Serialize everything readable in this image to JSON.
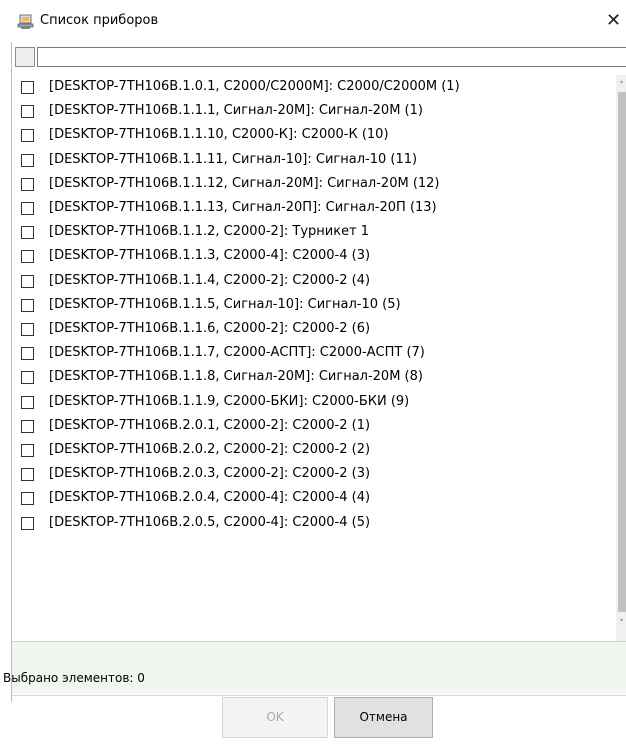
{
  "window": {
    "title": "Список приборов",
    "close_glyph": "✕",
    "app_icon": "device-list-icon",
    "close_icon": "close-icon"
  },
  "filter": {
    "value": "",
    "placeholder": ""
  },
  "items": [
    "[DESKTOP-7TH106B.1.0.1, С2000/С2000М]: С2000/С2000М (1)",
    "[DESKTOP-7TH106B.1.1.1, Сигнал-20М]: Сигнал-20М (1)",
    "[DESKTOP-7TH106B.1.1.10, С2000-К]: С2000-К (10)",
    "[DESKTOP-7TH106B.1.1.11, Сигнал-10]: Сигнал-10 (11)",
    "[DESKTOP-7TH106B.1.1.12, Сигнал-20М]: Сигнал-20М (12)",
    "[DESKTOP-7TH106B.1.1.13, Сигнал-20П]: Сигнал-20П (13)",
    "[DESKTOP-7TH106B.1.1.2, С2000-2]: Турникет 1",
    "[DESKTOP-7TH106B.1.1.3, С2000-4]: С2000-4 (3)",
    "[DESKTOP-7TH106B.1.1.4, С2000-2]: С2000-2 (4)",
    "[DESKTOP-7TH106B.1.1.5, Сигнал-10]: Сигнал-10 (5)",
    "[DESKTOP-7TH106B.1.1.6, С2000-2]: С2000-2 (6)",
    "[DESKTOP-7TH106B.1.1.7, С2000-АСПТ]: С2000-АСПТ (7)",
    "[DESKTOP-7TH106B.1.1.8, Сигнал-20М]: Сигнал-20М (8)",
    "[DESKTOP-7TH106B.1.1.9, С2000-БКИ]: С2000-БКИ (9)",
    "[DESKTOP-7TH106B.2.0.1, С2000-2]: С2000-2 (1)",
    "[DESKTOP-7TH106B.2.0.2, С2000-2]: С2000-2 (2)",
    "[DESKTOP-7TH106B.2.0.3, С2000-2]: С2000-2 (3)",
    "[DESKTOP-7TH106B.2.0.4, С2000-4]: С2000-4 (4)",
    "[DESKTOP-7TH106B.2.0.5, С2000-4]: С2000-4 (5)"
  ],
  "scrollbar": {
    "up_glyph": "˄",
    "down_glyph": "˅"
  },
  "status": {
    "selected_text": "Выбрано элементов: 0"
  },
  "buttons": {
    "ok_label": "OK",
    "cancel_label": "Отмена"
  }
}
